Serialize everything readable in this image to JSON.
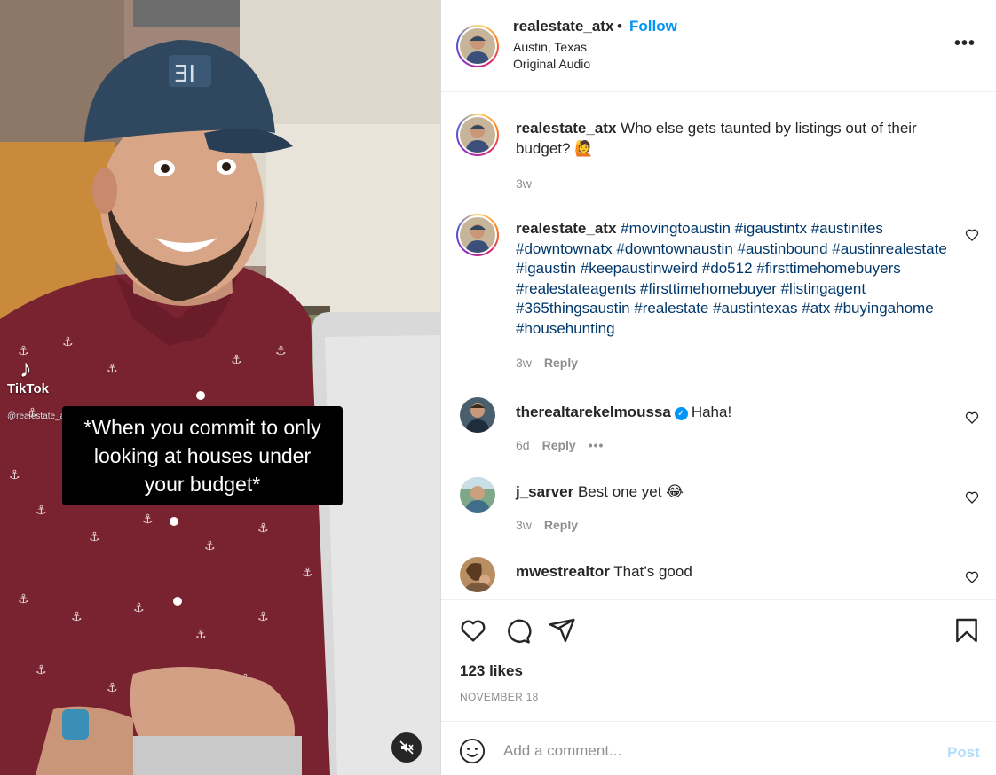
{
  "video": {
    "tiktok_brand": "TikTok",
    "tiktok_handle": "@realestate_atx",
    "caption_lines": [
      "*When you commit to only",
      "looking at houses under",
      "your budget*"
    ],
    "mute_icon": "speaker-muted-icon"
  },
  "header": {
    "username": "realestate_atx",
    "separator": "•",
    "follow_label": "Follow",
    "location": "Austin, Texas",
    "audio": "Original Audio",
    "more_label": "•••"
  },
  "comments": [
    {
      "user": "realestate_atx",
      "text": " Who else gets taunted by listings out of their budget? 🙋",
      "time": "3w"
    },
    {
      "user": "realestate_atx",
      "text": " #movingtoaustin #igaustintx #austinites #downtownatx #downtownaustin #austinbound #austinrealestate #igaustin #keepaustinweird #do512 #firsttimehomebuyers #realestateagents #firsttimehomebuyer #listingagent #365thingsaustin #realestate #austintexas #atx #buyingahome #househunting",
      "time": "3w",
      "reply": "Reply"
    },
    {
      "user": "therealtarekelmoussa",
      "verified": "✓",
      "text": "Haha!",
      "time": "6d",
      "reply": "Reply",
      "more": "•••"
    },
    {
      "user": "j_sarver",
      "text": " Best one yet 😂",
      "time": "3w",
      "reply": "Reply"
    },
    {
      "user": "mwestrealtor",
      "text": " That’s good"
    }
  ],
  "actions": {
    "likes": "123 likes",
    "date": "NOVEMBER 18"
  },
  "composer": {
    "placeholder": "Add a comment...",
    "post_label": "Post"
  },
  "colors": {
    "accent": "#0095f6",
    "hashtag": "#00376b",
    "muted": "#8e8e8e",
    "post_disabled": "#b2dffc"
  }
}
